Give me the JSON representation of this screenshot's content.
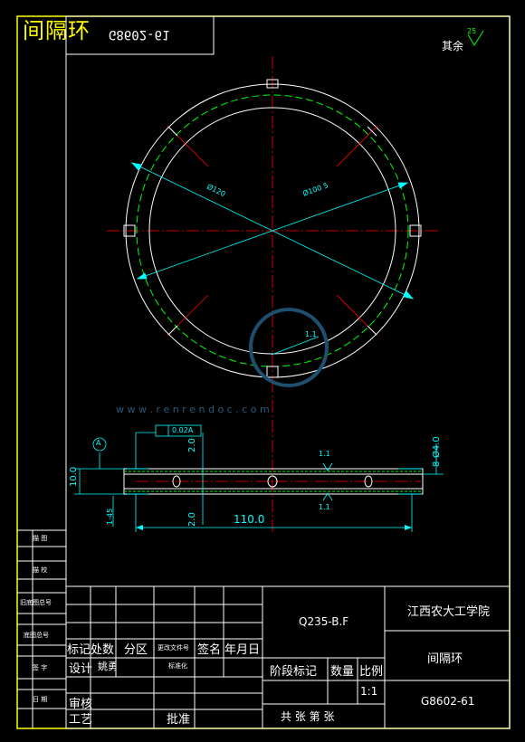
{
  "header": {
    "title": "间隔环",
    "drawing_no_mirrored": "G8602-61"
  },
  "surface_finish": {
    "label": "其余",
    "value": "25"
  },
  "watermark": {
    "url": "w w w . r e n r e n d o c . c o m"
  },
  "front_view": {
    "dim_d1": "Ø120",
    "dim_d2": "Ø100  5",
    "note": "1.1"
  },
  "section_view": {
    "datum": "A",
    "tolerance": "0.02A",
    "dim_width": "110.0",
    "dim_thickness": "10.0",
    "dim_holes": "8-Ø4.0",
    "dim_left_top": "2.0",
    "dim_left_bottom": "2.0",
    "dim_side": "1-45",
    "roughness_top": "1.1",
    "roughness_bottom": "1.1"
  },
  "side_bar": [
    {
      "label": "描 图"
    },
    {
      "label": "描 校"
    },
    {
      "label": "旧底图总号"
    },
    {
      "label": "底图总号"
    },
    {
      "label": "签 字"
    },
    {
      "label": "日 期"
    }
  ],
  "title_block": {
    "material": "Q235-B.F",
    "school": "江西农大工学院",
    "part_name": "间隔环",
    "drawing_no": "G8602-61",
    "row_labels": [
      "标记",
      "处数",
      "分区",
      "更改文件号",
      "签名",
      "年月日"
    ],
    "design_label": "设计",
    "designer": "姚勇",
    "standard_label": "标准化",
    "review_label": "审核",
    "process_label": "工艺",
    "approve_label": "批准",
    "stage_label": "阶段标记",
    "qty_label": "数量",
    "scale_label": "比例",
    "scale_value": "1:1",
    "sheets_label": "共   张   第   张"
  }
}
